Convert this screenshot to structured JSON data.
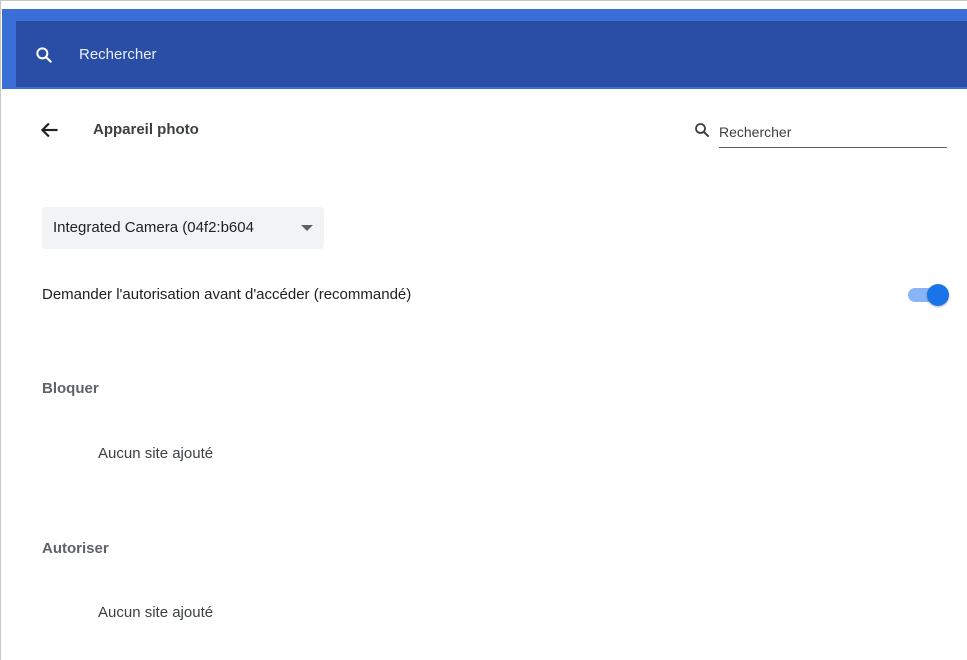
{
  "header": {
    "search_label": "Rechercher"
  },
  "subheader": {
    "title": "Appareil photo",
    "search_placeholder": "Rechercher"
  },
  "device_select": {
    "selected": "Integrated Camera (04f2:b604"
  },
  "ask_setting": {
    "label": "Demander l'autorisation avant d'accéder (recommandé)",
    "enabled": true
  },
  "block_section": {
    "heading": "Bloquer",
    "empty_text": "Aucun site ajouté"
  },
  "allow_section": {
    "heading": "Autoriser",
    "empty_text": "Aucun site ajouté"
  },
  "colors": {
    "header_outer": "#3b6fd8",
    "header_inner": "#2a4ea6",
    "toggle_track": "#8ab4f8",
    "toggle_knob": "#1a73e8"
  },
  "icons": {
    "header_search": "search-icon",
    "back": "back-arrow-icon",
    "subheader_search": "search-icon",
    "dropdown": "caret-down-icon"
  }
}
